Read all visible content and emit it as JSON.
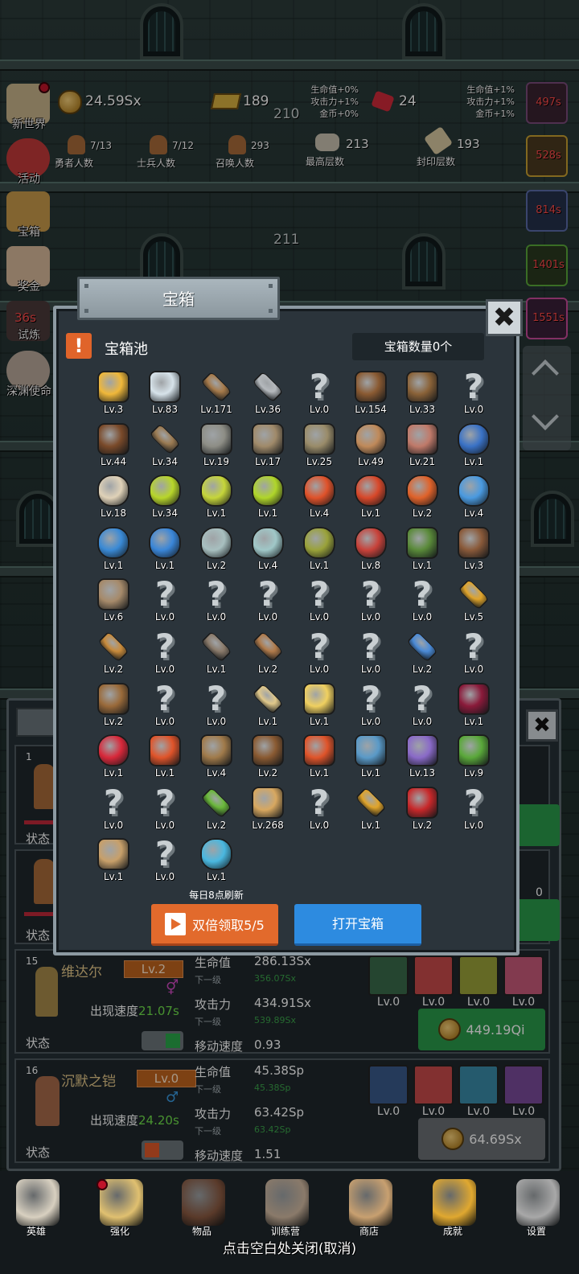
{
  "hud": {
    "coins": "24.59Sx",
    "gold_bars": "189",
    "gems": "24",
    "floor_number_top": "210",
    "floor_number_mid": "211",
    "left_bonus": [
      "生命值+0%",
      "攻击力+1%",
      "金币+0%"
    ],
    "right_bonus": [
      "生命值+1%",
      "攻击力+1%",
      "金币+1%"
    ],
    "stats": [
      {
        "value": "7/13",
        "label": "勇者人数"
      },
      {
        "value": "7/12",
        "label": "士兵人数"
      },
      {
        "value": "293",
        "label": "召唤人数"
      },
      {
        "value": "213",
        "label": "最高层数"
      },
      {
        "value": "193",
        "label": "封印层数"
      }
    ]
  },
  "side_menu": [
    {
      "label": "新世界",
      "icon": "map-icon",
      "color": "#c8b48a"
    },
    {
      "label": "活动",
      "icon": "heart-icon",
      "color": "#c23a3a"
    },
    {
      "label": "宝箱",
      "icon": "chest-icon",
      "color": "#c89a4a"
    },
    {
      "label": "奖金",
      "icon": "letter-icon",
      "color": "#d8b89a"
    },
    {
      "label": "试炼",
      "icon": "trial-icon",
      "color": "#4a3a3a"
    },
    {
      "label": "深渊使命",
      "icon": "orb-icon",
      "color": "#b9a89a"
    }
  ],
  "side_timer": "36s",
  "right_timers": [
    "497s",
    "528s",
    "814s",
    "1401s",
    "1551s"
  ],
  "modal": {
    "title": "宝箱",
    "pool_label": "宝箱池",
    "count_label": "宝箱数量0个",
    "refresh_note": "每日8点刷新",
    "double_button": "双倍领取5/5",
    "open_button": "打开宝箱",
    "close_symbol": "✖",
    "items": [
      {
        "icon": "crown-icon",
        "lv": "Lv.3",
        "color": "#f0b83a"
      },
      {
        "icon": "diamond-icon",
        "lv": "Lv.83",
        "color": "#d7e3ea"
      },
      {
        "icon": "sword-icon",
        "lv": "Lv.171",
        "color": "#a67a4a"
      },
      {
        "icon": "sword-icon",
        "lv": "Lv.36",
        "color": "#b5b9bd"
      },
      {
        "icon": "unknown-icon",
        "lv": "Lv.0",
        "color": ""
      },
      {
        "icon": "armor-icon",
        "lv": "Lv.154",
        "color": "#8a5a32"
      },
      {
        "icon": "backpack-icon",
        "lv": "Lv.33",
        "color": "#8a6238"
      },
      {
        "icon": "unknown-icon",
        "lv": "Lv.0",
        "color": ""
      },
      {
        "icon": "helmet-icon",
        "lv": "Lv.44",
        "color": "#7a4a2a"
      },
      {
        "icon": "dagger-icon",
        "lv": "Lv.34",
        "color": "#9a7a52"
      },
      {
        "icon": "helmet-icon",
        "lv": "Lv.19",
        "color": "#8e8e86"
      },
      {
        "icon": "hammer-icon",
        "lv": "Lv.17",
        "color": "#a08a6a"
      },
      {
        "icon": "helmet-icon",
        "lv": "Lv.25",
        "color": "#9a8c6a"
      },
      {
        "icon": "meat-icon",
        "lv": "Lv.49",
        "color": "#c08a5a"
      },
      {
        "icon": "steak-icon",
        "lv": "Lv.21",
        "color": "#c07a6a"
      },
      {
        "icon": "bag-icon",
        "lv": "Lv.1",
        "color": "#3a72c6"
      },
      {
        "icon": "bread-icon",
        "lv": "Lv.18",
        "color": "#e0d2b8"
      },
      {
        "icon": "potion-icon",
        "lv": "Lv.34",
        "color": "#b8d62a"
      },
      {
        "icon": "potion-icon",
        "lv": "Lv.1",
        "color": "#c6d63a"
      },
      {
        "icon": "potion-icon",
        "lv": "Lv.1",
        "color": "#b0d62a"
      },
      {
        "icon": "potion-icon",
        "lv": "Lv.4",
        "color": "#e0522a"
      },
      {
        "icon": "potion-icon",
        "lv": "Lv.1",
        "color": "#d8482a"
      },
      {
        "icon": "potion-icon",
        "lv": "Lv.2",
        "color": "#e0622a"
      },
      {
        "icon": "potion-icon",
        "lv": "Lv.4",
        "color": "#4a9ae0"
      },
      {
        "icon": "potion-icon",
        "lv": "Lv.1",
        "color": "#3a8ad6"
      },
      {
        "icon": "potion-icon",
        "lv": "Lv.1",
        "color": "#3a86d8"
      },
      {
        "icon": "bottle-icon",
        "lv": "Lv.2",
        "color": "#a8c0c0"
      },
      {
        "icon": "bottle-icon",
        "lv": "Lv.4",
        "color": "#a0c8c8"
      },
      {
        "icon": "bottle-icon",
        "lv": "Lv.1",
        "color": "#9aa23a"
      },
      {
        "icon": "bottle-icon",
        "lv": "Lv.8",
        "color": "#c8423a"
      },
      {
        "icon": "boot-icon",
        "lv": "Lv.1",
        "color": "#5a8a3a"
      },
      {
        "icon": "boot-icon",
        "lv": "Lv.3",
        "color": "#8a5a3a"
      },
      {
        "icon": "boot-icon",
        "lv": "Lv.6",
        "color": "#a68a6a"
      },
      {
        "icon": "unknown-icon",
        "lv": "Lv.0",
        "color": ""
      },
      {
        "icon": "unknown-icon",
        "lv": "Lv.0",
        "color": ""
      },
      {
        "icon": "unknown-icon",
        "lv": "Lv.0",
        "color": ""
      },
      {
        "icon": "unknown-icon",
        "lv": "Lv.0",
        "color": ""
      },
      {
        "icon": "unknown-icon",
        "lv": "Lv.0",
        "color": ""
      },
      {
        "icon": "unknown-icon",
        "lv": "Lv.0",
        "color": ""
      },
      {
        "icon": "torch-icon",
        "lv": "Lv.5",
        "color": "#e0a42a"
      },
      {
        "icon": "staff-icon",
        "lv": "Lv.2",
        "color": "#c88a3a"
      },
      {
        "icon": "unknown-icon",
        "lv": "Lv.0",
        "color": ""
      },
      {
        "icon": "pickaxe-icon",
        "lv": "Lv.1",
        "color": "#8a7a6a"
      },
      {
        "icon": "cane-icon",
        "lv": "Lv.2",
        "color": "#b07a4a"
      },
      {
        "icon": "unknown-icon",
        "lv": "Lv.0",
        "color": ""
      },
      {
        "icon": "unknown-icon",
        "lv": "Lv.0",
        "color": ""
      },
      {
        "icon": "wand-icon",
        "lv": "Lv.2",
        "color": "#4a8ad6"
      },
      {
        "icon": "unknown-icon",
        "lv": "Lv.0",
        "color": ""
      },
      {
        "icon": "backpack-icon",
        "lv": "Lv.2",
        "color": "#9a6a3a"
      },
      {
        "icon": "unknown-icon",
        "lv": "Lv.0",
        "color": ""
      },
      {
        "icon": "unknown-icon",
        "lv": "Lv.0",
        "color": ""
      },
      {
        "icon": "broom-icon",
        "lv": "Lv.1",
        "color": "#e0c88a"
      },
      {
        "icon": "cheese-icon",
        "lv": "Lv.1",
        "color": "#f0d060"
      },
      {
        "icon": "unknown-icon",
        "lv": "Lv.0",
        "color": ""
      },
      {
        "icon": "unknown-icon",
        "lv": "Lv.0",
        "color": ""
      },
      {
        "icon": "crystal-icon",
        "lv": "Lv.1",
        "color": "#8a1a3a"
      },
      {
        "icon": "red-orb-icon",
        "lv": "Lv.1",
        "color": "#d8283a"
      },
      {
        "icon": "cube-icon",
        "lv": "Lv.1",
        "color": "#e0542a"
      },
      {
        "icon": "bow-icon",
        "lv": "Lv.4",
        "color": "#a07a4a"
      },
      {
        "icon": "quiver-icon",
        "lv": "Lv.2",
        "color": "#8a5a32"
      },
      {
        "icon": "fire-gem-icon",
        "lv": "Lv.1",
        "color": "#e0542a"
      },
      {
        "icon": "rune-icon",
        "lv": "Lv.1",
        "color": "#5a9ac8"
      },
      {
        "icon": "rune-icon",
        "lv": "Lv.13",
        "color": "#8a6ac8"
      },
      {
        "icon": "amulet-icon",
        "lv": "Lv.9",
        "color": "#5aa83a"
      },
      {
        "icon": "unknown-icon",
        "lv": "Lv.0",
        "color": ""
      },
      {
        "icon": "unknown-icon",
        "lv": "Lv.0",
        "color": ""
      },
      {
        "icon": "mace-icon",
        "lv": "Lv.2",
        "color": "#6ab83a"
      },
      {
        "icon": "beer-icon",
        "lv": "Lv.268",
        "color": "#d8a860"
      },
      {
        "icon": "unknown-icon",
        "lv": "Lv.0",
        "color": ""
      },
      {
        "icon": "pickaxe-icon",
        "lv": "Lv.1",
        "color": "#e0a42a"
      },
      {
        "icon": "book-icon",
        "lv": "Lv.2",
        "color": "#c8282a"
      },
      {
        "icon": "unknown-icon",
        "lv": "Lv.0",
        "color": ""
      },
      {
        "icon": "whip-icon",
        "lv": "Lv.1",
        "color": "#c8a06a"
      },
      {
        "icon": "unknown-icon",
        "lv": "Lv.0",
        "color": ""
      },
      {
        "icon": "blue-orb-icon",
        "lv": "Lv.1",
        "color": "#4ab8e0"
      }
    ]
  },
  "hero_panel": {
    "card_numbers": [
      "1"
    ],
    "state_label": "状态",
    "next_level_label": "下一级",
    "heroes": [
      {
        "num": "15",
        "name": "维达尔",
        "level": "Lv.2",
        "gender": "⚥",
        "speed_label": "出现速度",
        "speed": "21.07s",
        "hp_label": "生命值",
        "hp": "286.13Sx",
        "hp_next": "356.07Sx",
        "atk_label": "攻击力",
        "atk": "434.91Sx",
        "atk_next": "539.89Sx",
        "move_label": "移动速度",
        "move": "0.93",
        "toggle_color": "#2aa84a",
        "skills": [
          {
            "icon": "leaf-skill-icon",
            "lv": "Lv.0",
            "color": "#3a6a4a"
          },
          {
            "icon": "sword-skill-icon",
            "lv": "Lv.0",
            "color": "#c84a4a"
          },
          {
            "icon": "staff-skill-icon",
            "lv": "Lv.0",
            "color": "#9aa23a"
          },
          {
            "icon": "boot-skill-icon",
            "lv": "Lv.0",
            "color": "#c85a7a"
          }
        ],
        "cost": "449.19Qi",
        "cost_color": "#2a9a4a"
      },
      {
        "num": "16",
        "name": "沉默之铠",
        "level": "Lv.0",
        "gender": "♂",
        "speed_label": "出现速度",
        "speed": "24.20s",
        "hp_label": "生命值",
        "hp": "45.38Sp",
        "hp_next": "45.38Sp",
        "atk_label": "攻击力",
        "atk": "63.42Sp",
        "atk_next": "63.42Sp",
        "move_label": "移动速度",
        "move": "1.51",
        "toggle_color": "#e05a2a",
        "skills": [
          {
            "icon": "shield-skill-icon",
            "lv": "Lv.0",
            "color": "#3a5a8a"
          },
          {
            "icon": "sword-skill-icon",
            "lv": "Lv.0",
            "color": "#c84a4a"
          },
          {
            "icon": "fist-skill-icon",
            "lv": "Lv.0",
            "color": "#3a8aa8"
          },
          {
            "icon": "hood-skill-icon",
            "lv": "Lv.0",
            "color": "#7a4a9a"
          }
        ],
        "cost": "64.69Sx",
        "cost_color": "#6a6f73"
      }
    ],
    "hidden_card_lvl": "0",
    "hidden_card_lvl2": "0"
  },
  "nav": [
    {
      "label": "英雄",
      "icon": "skull-icon",
      "color": "#d8d0c0"
    },
    {
      "label": "强化",
      "icon": "candle-icon",
      "color": "#e0c070"
    },
    {
      "label": "物品",
      "icon": "book-icon",
      "color": "#5a3a2a"
    },
    {
      "label": "训练营",
      "icon": "lantern-icon",
      "color": "#8a7a6a"
    },
    {
      "label": "商店",
      "icon": "mug-icon",
      "color": "#c8a070"
    },
    {
      "label": "成就",
      "icon": "key-icon",
      "color": "#e0a830"
    },
    {
      "label": "设置",
      "icon": "gear-icon",
      "color": "#a8a8a8"
    }
  ],
  "close_hint": "点击空白处关闭(取消)"
}
